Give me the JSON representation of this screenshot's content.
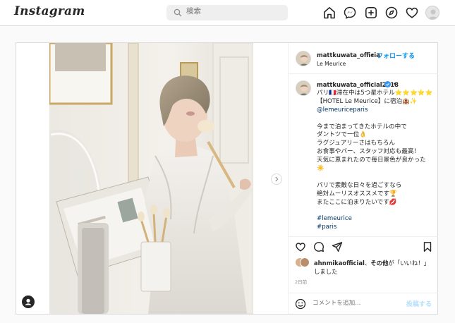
{
  "header": {
    "logo": "Instagram",
    "search_placeholder": "検索",
    "nav_icons": [
      "home-icon",
      "messenger-icon",
      "new-post-icon",
      "explore-icon",
      "activity-heart-icon",
      "profile-avatar"
    ]
  },
  "post": {
    "author": "mattkuwata_officia",
    "follow_label": "フォローする",
    "location": "Le Meurice",
    "caption": {
      "author": "mattkuwata_official2018",
      "lines": [
        "パリ🇫🇷滞在中は5つ星ホテル⭐⭐⭐⭐⭐",
        "【HOTEL Le Meurice】に宿泊🏨✨",
        "@lemeuriceparis",
        "",
        "今まで泊まってきたホテルの中で",
        "ダントツで一位👌",
        "ラグジュアリーさはもちろん",
        "お食事やバー、スタッフ対応も最高！",
        "天気に恵まれたので毎日景色が良かった",
        "☀️",
        "",
        "パリで素敵な日々を過ごすなら",
        "絶対ムーリスオススメです🏆",
        "またここに泊まりたいです💋",
        "",
        "#lemeurice",
        "#paris"
      ]
    },
    "likes": {
      "user": "ahnmikaofficial",
      "text_after_user": "、",
      "others": "その他",
      "suffix": "が「いいね！」",
      "line2": "しました"
    },
    "date": "2日前",
    "comment_placeholder": "コメントを追加...",
    "post_button": "投稿する"
  },
  "colors": {
    "accent": "#0095f6",
    "link": "#00376b",
    "border": "#dbdbdb",
    "muted": "#8e8e8e"
  }
}
